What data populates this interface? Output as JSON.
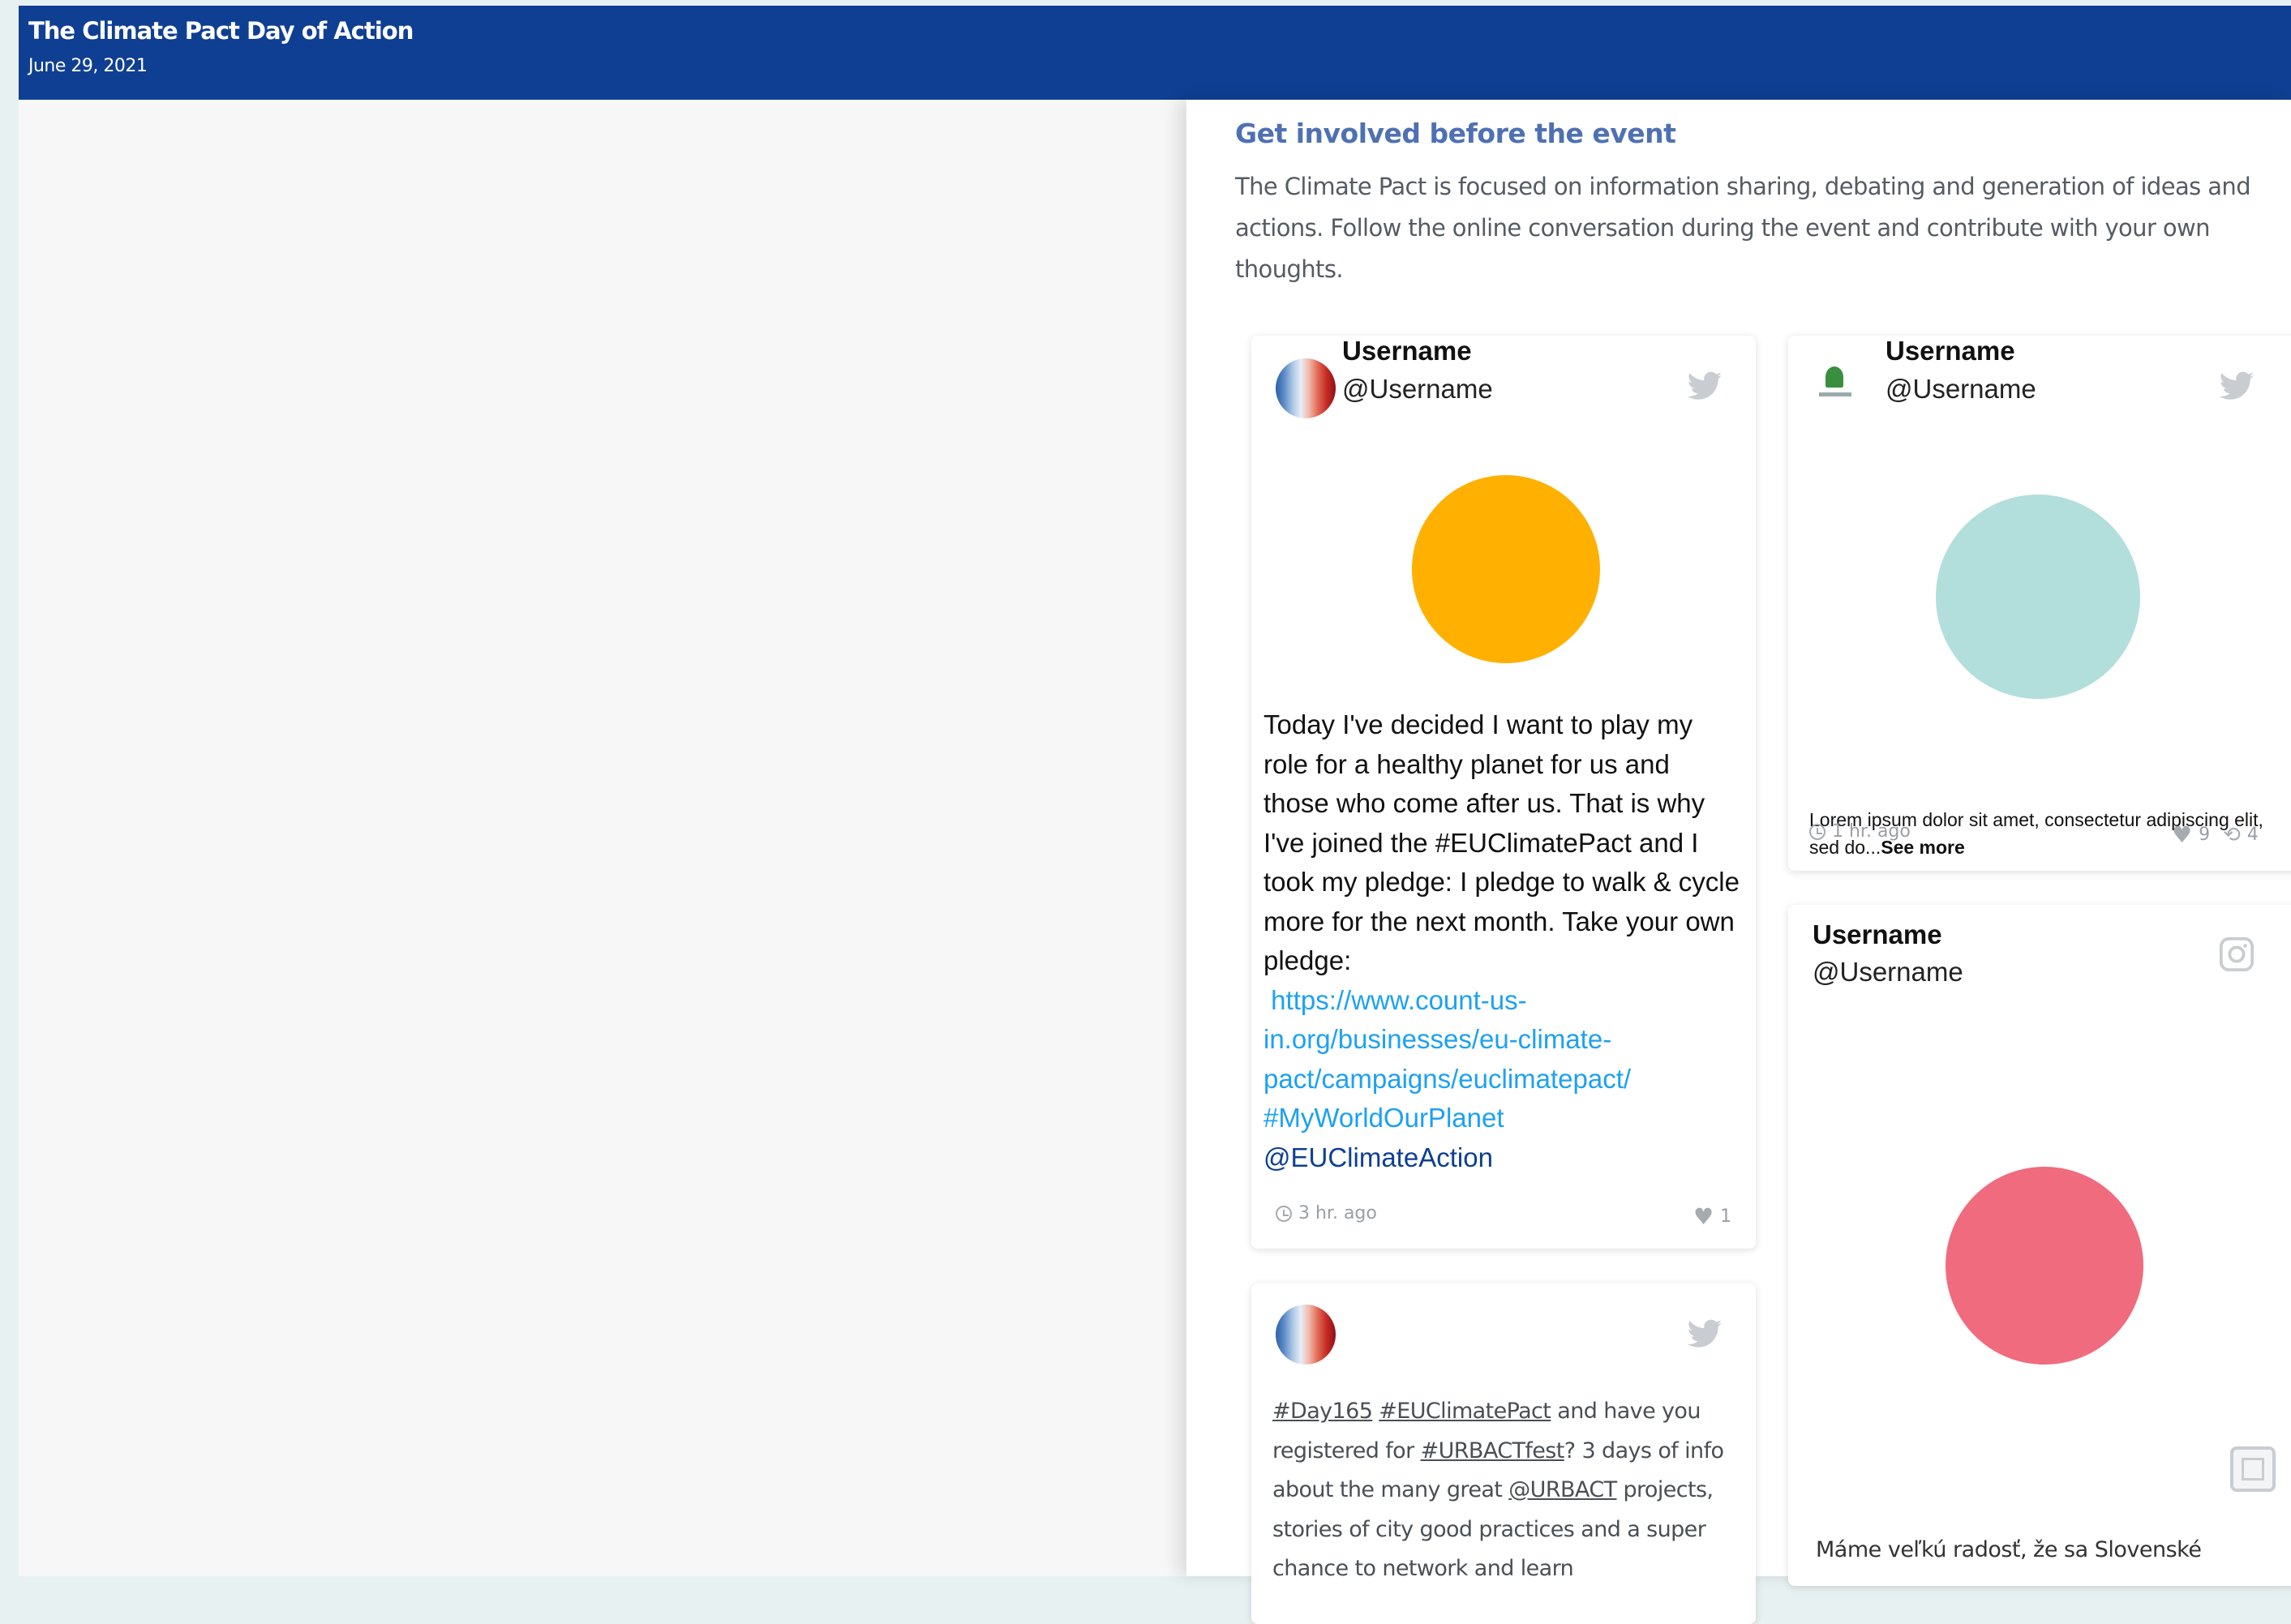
{
  "header": {
    "title": "The Climate Pact Day of Action",
    "date": "June 29, 2021"
  },
  "section": {
    "heading": "Get involved before the event",
    "intro": "The Climate Pact is focused on information sharing, debating and generation of ideas and actions. Follow the online conversation during the event and contribute with your own thoughts."
  },
  "colors": {
    "header_bg": "#0f3f92",
    "heading": "#4f71b3",
    "link": "#1da1f2",
    "mention": "#0f3f92"
  },
  "posts": [
    {
      "username": "Username",
      "handle": "@Username",
      "platform": "twitter-icon",
      "media_color": "#ffb000",
      "text": "Today I've decided I want to play my role for a healthy planet for us and those who come after us. That is why I've joined the #EUClimatePact and I took my pledge: I pledge to walk & cycle more for the next month. Take your own pledge:",
      "link": "https://www.count-us-in.org/businesses/eu-climate-pact/campaigns/euclimatepact/",
      "hashtag": "#MyWorldOurPlanet",
      "mention": "@EUClimateAction",
      "time": "3 hr. ago",
      "likes": "1"
    },
    {
      "username": "Username",
      "handle": "@Username",
      "platform": "twitter-icon",
      "media_color": "#b2dfdb",
      "text": "Lorem ipsum dolor sit amet, consectetur adipiscing elit, sed do...",
      "see_more": "See more",
      "time": "1  hr. ago",
      "likes": "9",
      "retweets": "4"
    },
    {
      "username": "Username",
      "handle": "@Username",
      "platform": "instagram-icon",
      "media_color": "#f06b7d",
      "text": "Máme veľkú radosť, že sa Slovenské"
    },
    {
      "platform": "twitter-icon",
      "tags": [
        "#Day165",
        "#EUClimatePact",
        "#URBACTfest",
        "@URBACT"
      ],
      "text_parts": [
        " and have you registered for ",
        "? 3 days of info about the many great ",
        " projects, stories of city good practices and a super chance to network and learn"
      ]
    }
  ]
}
